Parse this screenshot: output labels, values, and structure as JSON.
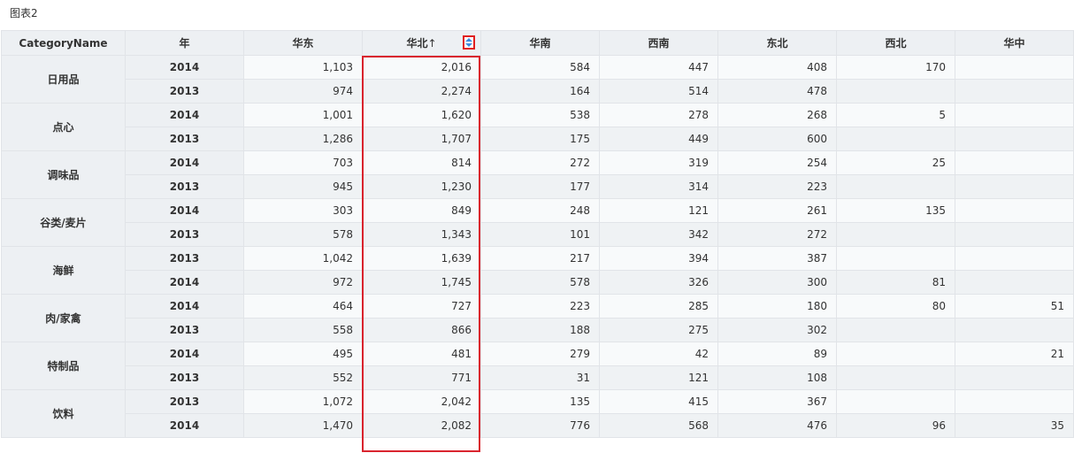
{
  "title": "图表2",
  "sort_indicator": "↑",
  "columns": [
    "CategoryName",
    "年",
    "华东",
    "华北",
    "华南",
    "西南",
    "东北",
    "西北",
    "华中"
  ],
  "categories": [
    {
      "name": "日用品",
      "rows": [
        {
          "year": "2014",
          "values": [
            "1,103",
            "2,016",
            "584",
            "447",
            "408",
            "170",
            ""
          ]
        },
        {
          "year": "2013",
          "values": [
            "974",
            "2,274",
            "164",
            "514",
            "478",
            "",
            ""
          ]
        }
      ]
    },
    {
      "name": "点心",
      "rows": [
        {
          "year": "2014",
          "values": [
            "1,001",
            "1,620",
            "538",
            "278",
            "268",
            "5",
            ""
          ]
        },
        {
          "year": "2013",
          "values": [
            "1,286",
            "1,707",
            "175",
            "449",
            "600",
            "",
            ""
          ]
        }
      ]
    },
    {
      "name": "调味品",
      "rows": [
        {
          "year": "2014",
          "values": [
            "703",
            "814",
            "272",
            "319",
            "254",
            "25",
            ""
          ]
        },
        {
          "year": "2013",
          "values": [
            "945",
            "1,230",
            "177",
            "314",
            "223",
            "",
            ""
          ]
        }
      ]
    },
    {
      "name": "谷类/麦片",
      "rows": [
        {
          "year": "2014",
          "values": [
            "303",
            "849",
            "248",
            "121",
            "261",
            "135",
            ""
          ]
        },
        {
          "year": "2013",
          "values": [
            "578",
            "1,343",
            "101",
            "342",
            "272",
            "",
            ""
          ]
        }
      ]
    },
    {
      "name": "海鲜",
      "rows": [
        {
          "year": "2013",
          "values": [
            "1,042",
            "1,639",
            "217",
            "394",
            "387",
            "",
            ""
          ]
        },
        {
          "year": "2014",
          "values": [
            "972",
            "1,745",
            "578",
            "326",
            "300",
            "81",
            ""
          ]
        }
      ]
    },
    {
      "name": "肉/家禽",
      "rows": [
        {
          "year": "2014",
          "values": [
            "464",
            "727",
            "223",
            "285",
            "180",
            "80",
            "51"
          ]
        },
        {
          "year": "2013",
          "values": [
            "558",
            "866",
            "188",
            "275",
            "302",
            "",
            ""
          ]
        }
      ]
    },
    {
      "name": "特制品",
      "rows": [
        {
          "year": "2014",
          "values": [
            "495",
            "481",
            "279",
            "42",
            "89",
            "",
            "21"
          ]
        },
        {
          "year": "2013",
          "values": [
            "552",
            "771",
            "31",
            "121",
            "108",
            "",
            ""
          ]
        }
      ]
    },
    {
      "name": "饮料",
      "rows": [
        {
          "year": "2013",
          "values": [
            "1,072",
            "2,042",
            "135",
            "415",
            "367",
            "",
            ""
          ]
        },
        {
          "year": "2014",
          "values": [
            "1,470",
            "2,082",
            "776",
            "568",
            "476",
            "96",
            "35"
          ]
        }
      ]
    }
  ],
  "colors": {
    "highlight": "#d9232d",
    "sort_icon": "#3b8de0"
  }
}
